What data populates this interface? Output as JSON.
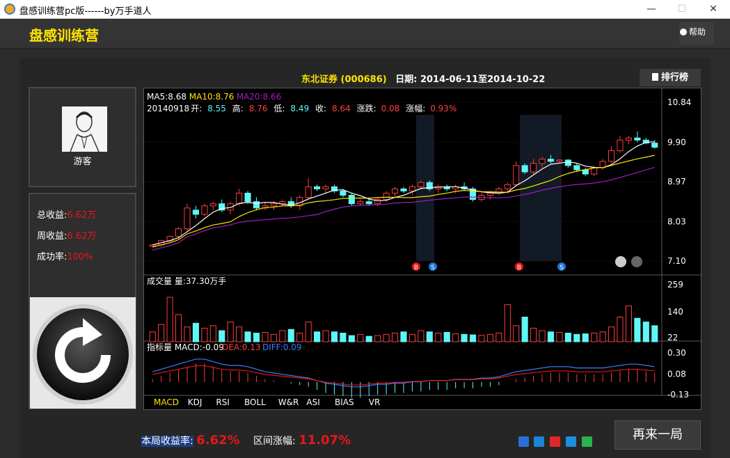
{
  "window": {
    "title": "盘感训练营pc版------by万手道人",
    "min": "—",
    "max": "☐",
    "close": "✕"
  },
  "header": {
    "app_name": "盘感训练营",
    "help": "帮助"
  },
  "stock": {
    "name": "东北证券",
    "code": "(000686)",
    "date_range": "日期: 2014-06-11至2014-10-22"
  },
  "rank_button": "排行榜",
  "user": {
    "name": "游客"
  },
  "stats": [
    {
      "label": "总收益:",
      "value": "6.62万"
    },
    {
      "label": "周收益:",
      "value": "6.62万"
    },
    {
      "label": "成功率:",
      "value": "100%"
    }
  ],
  "chart_data": {
    "type": "candlestick",
    "ma_legend": [
      {
        "text": "MA5:8.68",
        "color": "#ffffff"
      },
      {
        "text": "MA10:8.76",
        "color": "#ffe400"
      },
      {
        "text": "MA20:8.66",
        "color": "#a020c0"
      }
    ],
    "ohlc_line": {
      "date": "20140918",
      "items": [
        {
          "label": "开:",
          "value": "8.55",
          "color": "#5ff6f6"
        },
        {
          "label": "高:",
          "value": "8.76",
          "color": "#ff4040"
        },
        {
          "label": "低:",
          "value": "8.49",
          "color": "#5ff6f6"
        },
        {
          "label": "收:",
          "value": "8.64",
          "color": "#ff4040"
        },
        {
          "label": "涨跌:",
          "value": "0.08",
          "color": "#ff4040"
        },
        {
          "label": "涨幅:",
          "value": "0.93%",
          "color": "#ff4040"
        }
      ]
    },
    "price_ticks": [
      "10.84",
      "9.90",
      "8.97",
      "8.03",
      "7.10"
    ],
    "price_range": [
      7.1,
      10.84
    ],
    "volume_label": "成交量 量:37.30万手",
    "volume_ticks": [
      "259",
      "140",
      "22"
    ],
    "volume_range": [
      0,
      259
    ],
    "macd_label": {
      "title": "指标量",
      "macd": "MACD:-0.09",
      "dea": "DEA:0.13",
      "diff": "DIFF:0.09"
    },
    "macd_ticks": [
      "0.30",
      "0.08",
      "-0.13"
    ],
    "macd_range": [
      -0.13,
      0.3
    ],
    "indicator_tabs": [
      "MACD",
      "KDJ",
      "RSI",
      "BOLL",
      "W&R",
      "ASI",
      "BIAS",
      "VR"
    ],
    "trade_markers": [
      "B",
      "S",
      "B",
      "S"
    ],
    "candles": [
      [
        7.45,
        7.5,
        7.42,
        7.48
      ],
      [
        7.48,
        7.6,
        7.44,
        7.58
      ],
      [
        7.58,
        7.7,
        7.52,
        7.68
      ],
      [
        7.68,
        7.9,
        7.62,
        7.86
      ],
      [
        7.86,
        8.45,
        7.8,
        8.35
      ],
      [
        8.3,
        8.4,
        8.1,
        8.2
      ],
      [
        8.2,
        8.45,
        8.15,
        8.4
      ],
      [
        8.4,
        8.5,
        8.3,
        8.45
      ],
      [
        8.45,
        8.55,
        8.25,
        8.3
      ],
      [
        8.3,
        8.5,
        8.2,
        8.45
      ],
      [
        8.45,
        8.8,
        8.4,
        8.7
      ],
      [
        8.7,
        8.75,
        8.45,
        8.5
      ],
      [
        8.5,
        8.6,
        8.3,
        8.35
      ],
      [
        8.35,
        8.5,
        8.3,
        8.4
      ],
      [
        8.4,
        8.5,
        8.3,
        8.45
      ],
      [
        8.45,
        8.55,
        8.4,
        8.5
      ],
      [
        8.5,
        8.6,
        8.35,
        8.4
      ],
      [
        8.4,
        8.65,
        8.3,
        8.6
      ],
      [
        8.6,
        9.05,
        8.55,
        8.85
      ],
      [
        8.85,
        8.9,
        8.75,
        8.8
      ],
      [
        8.8,
        8.9,
        8.7,
        8.85
      ],
      [
        8.85,
        8.9,
        8.7,
        8.75
      ],
      [
        8.75,
        8.8,
        8.6,
        8.65
      ],
      [
        8.65,
        8.7,
        8.4,
        8.45
      ],
      [
        8.45,
        8.55,
        8.4,
        8.5
      ],
      [
        8.5,
        8.6,
        8.4,
        8.45
      ],
      [
        8.45,
        8.6,
        8.4,
        8.55
      ],
      [
        8.55,
        8.75,
        8.5,
        8.7
      ],
      [
        8.7,
        8.85,
        8.6,
        8.8
      ],
      [
        8.8,
        8.85,
        8.7,
        8.75
      ],
      [
        8.75,
        8.9,
        8.65,
        8.85
      ],
      [
        8.85,
        9.0,
        8.8,
        8.95
      ],
      [
        8.95,
        9.0,
        8.75,
        8.8
      ],
      [
        8.8,
        8.9,
        8.7,
        8.85
      ],
      [
        8.85,
        8.9,
        8.75,
        8.8
      ],
      [
        8.8,
        8.9,
        8.7,
        8.85
      ],
      [
        8.85,
        8.95,
        8.75,
        8.8
      ],
      [
        8.8,
        8.85,
        8.5,
        8.55
      ],
      [
        8.55,
        8.7,
        8.5,
        8.65
      ],
      [
        8.65,
        8.75,
        8.55,
        8.7
      ],
      [
        8.7,
        8.85,
        8.65,
        8.8
      ],
      [
        8.8,
        8.95,
        8.7,
        8.9
      ],
      [
        8.9,
        9.45,
        8.85,
        9.35
      ],
      [
        9.35,
        9.4,
        9.15,
        9.2
      ],
      [
        9.2,
        9.5,
        9.15,
        9.4
      ],
      [
        9.4,
        9.55,
        9.3,
        9.5
      ],
      [
        9.5,
        9.6,
        9.4,
        9.45
      ],
      [
        9.45,
        9.5,
        9.4,
        9.48
      ],
      [
        9.48,
        9.5,
        9.3,
        9.35
      ],
      [
        9.35,
        9.4,
        9.2,
        9.25
      ],
      [
        9.25,
        9.3,
        9.1,
        9.15
      ],
      [
        9.15,
        9.35,
        9.1,
        9.3
      ],
      [
        9.3,
        9.5,
        9.25,
        9.45
      ],
      [
        9.45,
        9.8,
        9.4,
        9.7
      ],
      [
        9.7,
        10.05,
        9.65,
        9.95
      ],
      [
        9.95,
        10.05,
        9.85,
        10.0
      ],
      [
        10.0,
        10.15,
        9.9,
        9.95
      ],
      [
        9.95,
        10.0,
        9.85,
        9.88
      ],
      [
        9.88,
        9.95,
        9.75,
        9.78
      ]
    ],
    "volumes": [
      40,
      70,
      180,
      110,
      60,
      75,
      55,
      65,
      45,
      80,
      60,
      40,
      35,
      38,
      30,
      45,
      50,
      35,
      80,
      40,
      45,
      40,
      35,
      25,
      30,
      22,
      25,
      30,
      35,
      40,
      30,
      45,
      40,
      35,
      38,
      32,
      30,
      28,
      26,
      30,
      35,
      150,
      65,
      100,
      55,
      45,
      40,
      38,
      35,
      30,
      32,
      35,
      40,
      60,
      100,
      145,
      95,
      80,
      65
    ],
    "macd_hist": [
      0.02,
      0.04,
      0.06,
      0.08,
      0.1,
      0.12,
      0.12,
      0.1,
      0.08,
      0.07,
      0.07,
      0.06,
      0.04,
      0.02,
      0.01,
      0.0,
      -0.01,
      -0.02,
      -0.03,
      -0.05,
      -0.07,
      -0.08,
      -0.09,
      -0.1,
      -0.1,
      -0.09,
      -0.08,
      -0.08,
      -0.07,
      -0.07,
      -0.06,
      -0.06,
      -0.05,
      -0.05,
      -0.05,
      -0.04,
      -0.04,
      -0.04,
      -0.03,
      -0.03,
      -0.02,
      0.0,
      0.02,
      0.03,
      0.04,
      0.05,
      0.06,
      0.06,
      0.06,
      0.05,
      0.05,
      0.05,
      0.05,
      0.06,
      0.07,
      0.08,
      0.08,
      0.07,
      0.06
    ]
  },
  "bottom": {
    "round_return_label": "本局收益率:",
    "round_return_value": "6.62%",
    "range_change_label": "区间涨幅:",
    "range_change_value": "11.07%",
    "again_button": "再来一局"
  },
  "share_icons": [
    "plus-share-icon",
    "qzone-icon",
    "weibo-icon",
    "tencent-weibo-icon",
    "wechat-icon"
  ]
}
